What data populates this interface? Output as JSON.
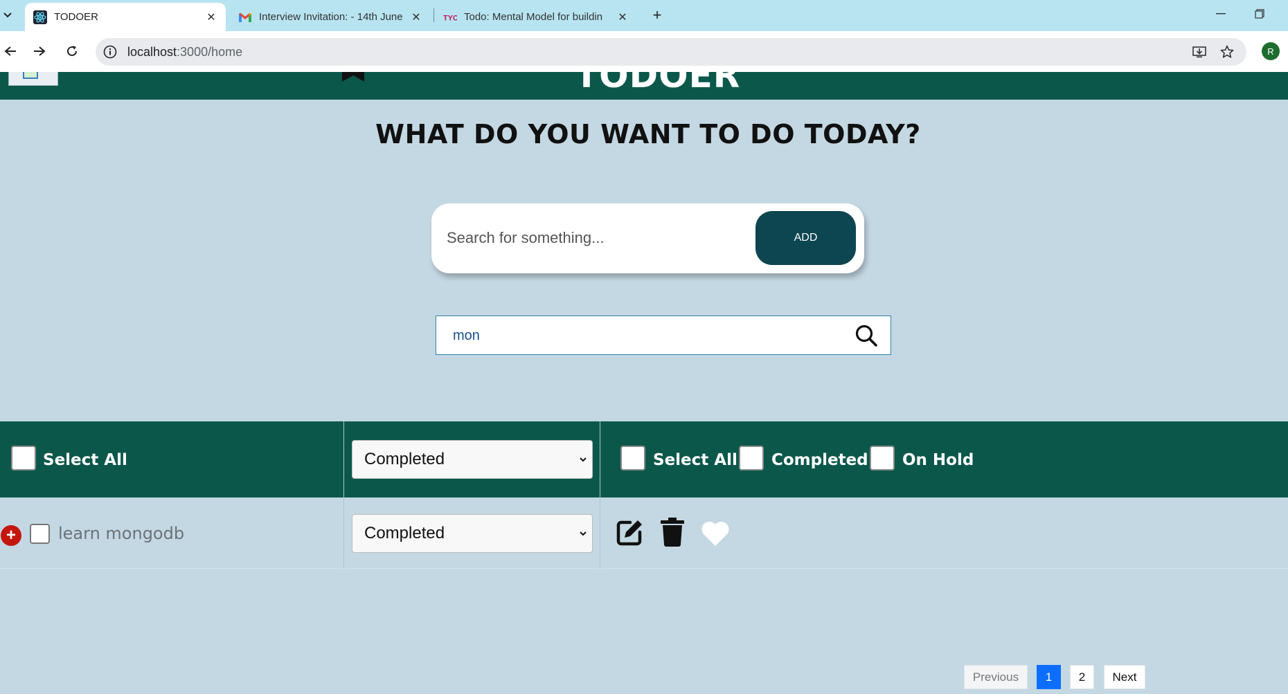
{
  "browser": {
    "tabs": [
      {
        "title": "TODOER",
        "active": true,
        "icon": "react-icon"
      },
      {
        "title": "Interview Invitation: - 14th June",
        "active": false,
        "icon": "gmail-icon"
      },
      {
        "title": "Todo: Mental Model for buildin",
        "active": false,
        "icon": "tyc-icon"
      }
    ],
    "url_host": "localhost",
    "url_path": ":3000/home",
    "profile_initial": "R"
  },
  "app": {
    "brand": "TODOER",
    "heading": "WHAT DO YOU WANT TO DO TODAY?",
    "add_placeholder": "Search for something...",
    "add_label": "ADD",
    "search_value": "mon"
  },
  "table": {
    "header": {
      "select_all_label": "Select All",
      "status_value": "Completed",
      "filters": [
        "Select All",
        "Completed",
        "On Hold"
      ]
    },
    "rows": [
      {
        "text": "learn mongodb",
        "status": "Completed",
        "checked": false
      }
    ]
  },
  "pagination": {
    "previous": "Previous",
    "pages": [
      "1",
      "2"
    ],
    "current_page": "1",
    "next": "Next"
  },
  "colors": {
    "header_green": "#0b584b",
    "page_bg": "#c4d8e3",
    "add_button": "#0d4650",
    "active_page": "#0d6efd",
    "expand_red": "#c4160d"
  }
}
